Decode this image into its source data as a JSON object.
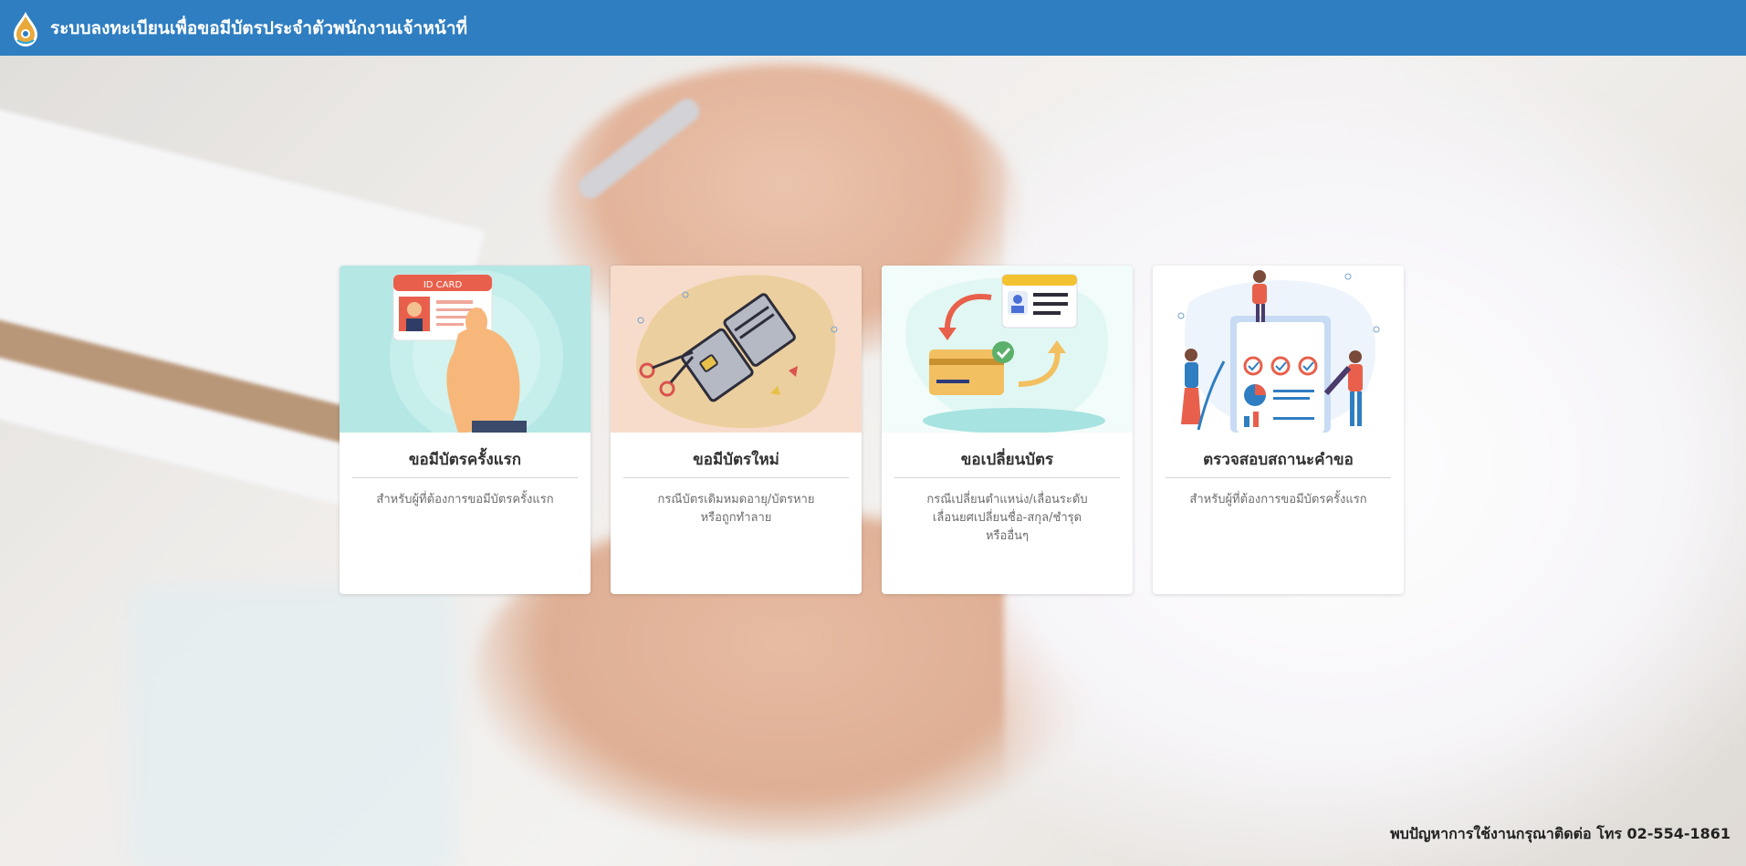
{
  "header": {
    "title": "ระบบลงทะเบียนเพื่อขอมีบัตรประจำตัวพนักงานเจ้าหน้าที่",
    "logo_icon": "water-drop-emblem-icon",
    "background_color": "#2f7ec1"
  },
  "cards": [
    {
      "title": "ขอมีบัตรครั้งแรก",
      "description": "สำหรับผู้ที่ต้องการขอมีบัตรครั้งแรก",
      "image_icon": "hand-holding-id-card-icon",
      "image_text": "ID CARD",
      "image_bg": "#b7e8e6"
    },
    {
      "title": "ขอมีบัตรใหม่",
      "description": "กรณีบัตรเดิมหมดอายุ/บัตรหาย\nหรือถูกทำลาย",
      "image_icon": "cut-card-scissors-icon",
      "image_bg": "#f6dcc9"
    },
    {
      "title": "ขอเปลี่ยนบัตร",
      "description": "กรณีเปลี่ยนตำแหน่ง/เลื่อนระดับ\nเลื่อนยศเปลี่ยนชื่อ-สกุล/ชำรุด\nหรืออื่นๆ",
      "image_icon": "card-exchange-arrows-icon",
      "image_bg": "#eefbf8"
    },
    {
      "title": "ตรวจสอบสถานะคำขอ",
      "description": "สำหรับผู้ที่ต้องการขอมีบัตรครั้งแรก",
      "image_icon": "checklist-people-icon",
      "image_bg": "#ffffff"
    }
  ],
  "footer": {
    "contact": "พบปัญหาการใช้งานกรุณาติดต่อ โทร 02-554-1861"
  }
}
